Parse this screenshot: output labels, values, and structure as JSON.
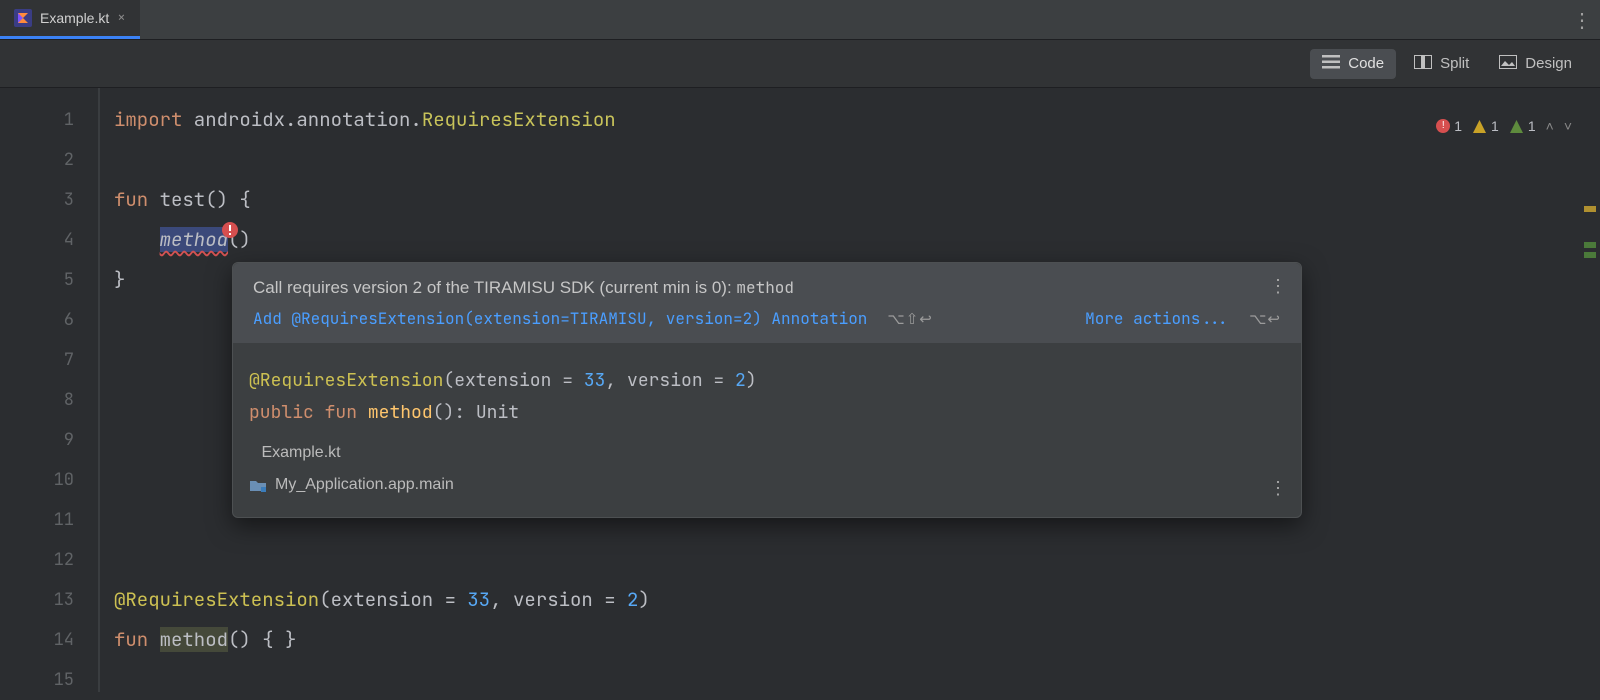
{
  "tab": {
    "filename": "Example.kt",
    "close_glyph": "×"
  },
  "view_modes": {
    "code": "Code",
    "split": "Split",
    "design": "Design",
    "active": "Code"
  },
  "inspections": {
    "errors": "1",
    "warnings": "1",
    "weak_warnings": "1"
  },
  "gutter_lines": [
    "1",
    "2",
    "3",
    "4",
    "5",
    "6",
    "7",
    "8",
    "9",
    "10",
    "11",
    "12",
    "13",
    "14",
    "15"
  ],
  "code": {
    "l1_kw": "import",
    "l1_pkg": " androidx.annotation.",
    "l1_class": "RequiresExtension",
    "l3_kw": "fun",
    "l3_rest": " test() {",
    "l4_indent": "    ",
    "l4_method": "method",
    "l4_paren": "()",
    "l5": "}",
    "l13_ann": "@RequiresExtension",
    "l13_open": "(extension = ",
    "l13_n1": "33",
    "l13_mid": ", version = ",
    "l13_n2": "2",
    "l13_close": ")",
    "l14_kw": "fun",
    "l14_sp": " ",
    "l14_fn": "method",
    "l14_rest": "() { }"
  },
  "popup": {
    "title_pre": "Call requires version 2 of the TIRAMISU SDK (current min is 0): ",
    "title_mono": "method",
    "fix_label": "Add @RequiresExtension(extension=TIRAMISU, version=2) Annotation",
    "fix_shortcut": "⌥⇧↩",
    "more_label": "More actions...",
    "more_shortcut": "⌥↩",
    "sig_ann": "@RequiresExtension",
    "sig_open": "(extension = ",
    "sig_n1": "33",
    "sig_mid": ", version = ",
    "sig_n2": "2",
    "sig_close": ")",
    "sig_kw1": "public",
    "sig_kw2": "fun",
    "sig_fn": "method",
    "sig_rest": "(): Unit",
    "loc_file": "Example.kt",
    "loc_module": "My_Application.app.main"
  }
}
